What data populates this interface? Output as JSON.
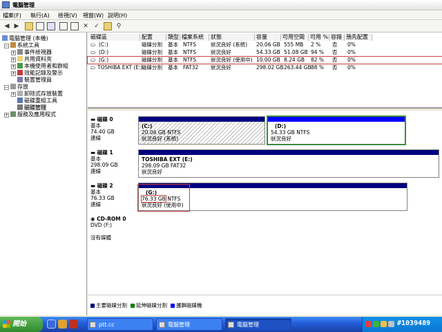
{
  "window": {
    "title": "電腦管理"
  },
  "menu": [
    "檔案(F)",
    "執行(A)",
    "檢視(V)",
    "視窗(W)",
    "說明(H)"
  ],
  "toolbar": {
    "icons": [
      "back-icon",
      "forward-icon",
      "up-folder-icon",
      "properties-icon",
      "help-icon",
      "refresh-icon",
      "delete-icon",
      "check-icon",
      "folder-icon",
      "search-icon",
      "disk-icon"
    ]
  },
  "tree": {
    "root": "電腦管理 (本機)",
    "system_tools": "系統工具",
    "event_viewer": "事件檢視器",
    "shared_folders": "共用資料夾",
    "local_users": "本機使用者和群組",
    "perf_logs": "效能記錄及警示",
    "device_manager": "裝置管理員",
    "storage": "存放",
    "removable_storage": "卸除式存放裝置",
    "defrag": "磁碟重組工具",
    "disk_mgmt": "磁碟管理",
    "services": "服務及應用程式"
  },
  "volumes": {
    "headers": [
      "磁碟區",
      "配置",
      "類型",
      "檔案系統",
      "狀態",
      "容量",
      "可用空間",
      "可用 %",
      "容錯",
      "預先配置"
    ],
    "rows": [
      {
        "name": "(C:)",
        "layout": "磁碟分割",
        "type": "基本",
        "fs": "NTFS",
        "status": "狀況良好 (系統)",
        "capacity": "20.06 GB",
        "free": "555 MB",
        "pct": "2 %",
        "ft": "否",
        "overhead": "0%"
      },
      {
        "name": "(D:)",
        "layout": "磁碟分割",
        "type": "基本",
        "fs": "NTFS",
        "status": "狀況良好",
        "capacity": "54.33 GB",
        "free": "51.08 GB",
        "pct": "94 %",
        "ft": "否",
        "overhead": "0%"
      },
      {
        "name": "(G:)",
        "layout": "磁碟分割",
        "type": "基本",
        "fs": "NTFS",
        "status": "狀況良好 (使用中)",
        "capacity": "10.00 GB",
        "free": "8.24 GB",
        "pct": "82 %",
        "ft": "否",
        "overhead": "0%"
      },
      {
        "name": "TOSHIBA EXT (E:)",
        "layout": "磁碟分割",
        "type": "基本",
        "fs": "FAT32",
        "status": "狀況良好",
        "capacity": "298.02 GB",
        "free": "263.44 GB",
        "pct": "88 %",
        "ft": "否",
        "overhead": "0%"
      }
    ]
  },
  "disks": [
    {
      "name": "磁碟 0",
      "type": "基本",
      "size": "74.40 GB",
      "state": "連線",
      "parts": [
        {
          "title": "(C:)",
          "info": "20.06 GB NTFS",
          "status": "狀況良好 (系統)"
        },
        {
          "title": "(D:)",
          "info": "54.33 GB NTFS",
          "status": "狀況良好"
        }
      ]
    },
    {
      "name": "磁碟 1",
      "type": "基本",
      "size": "298.09 GB",
      "state": "連線",
      "parts": [
        {
          "title": "TOSHIBA EXT  (E:)",
          "info": "298.09 GB FAT32",
          "status": "狀況良好"
        }
      ]
    },
    {
      "name": "磁碟 2",
      "type": "基本",
      "size": "76.33 GB",
      "state": "連線",
      "parts": [
        {
          "title": "(G:)",
          "info_size": "76.33 GB",
          "info_fs": "NTFS",
          "status": "狀況良好 (使用中)"
        }
      ]
    },
    {
      "name": "CD-ROM 0",
      "type": "DVD (F:)",
      "state": "沒有媒體"
    }
  ],
  "legend": [
    {
      "label": "主要磁碟分割",
      "color": "#000080"
    },
    {
      "label": "延伸磁碟分割",
      "color": "#008000"
    },
    {
      "label": "邏輯磁碟機",
      "color": "#0000ff"
    }
  ],
  "taskbar": {
    "start": "開始",
    "tasks": [
      "ptt.cc",
      "電腦管理",
      "電腦管理"
    ],
    "stamp": "#1039489"
  }
}
